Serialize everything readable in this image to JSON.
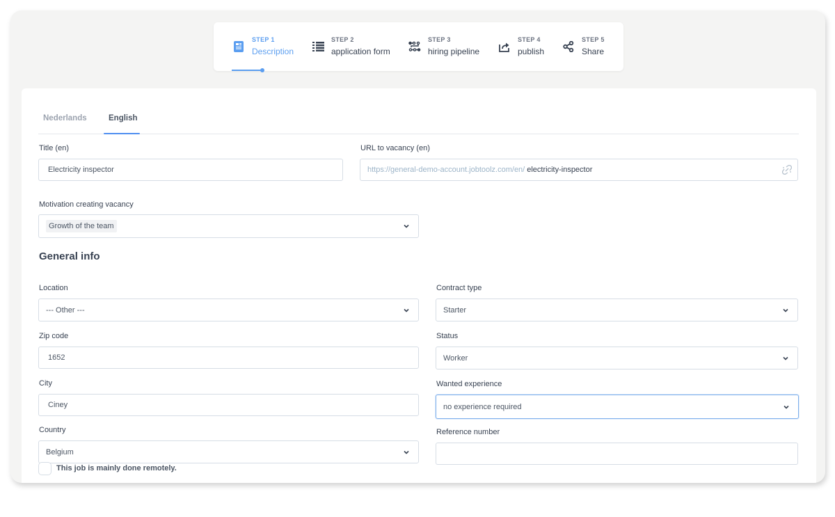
{
  "stepper": {
    "steps": [
      {
        "number": "STEP 1",
        "label": "Description",
        "icon": "document-icon",
        "active": true
      },
      {
        "number": "STEP 2",
        "label": "application form",
        "icon": "list-icon",
        "active": false
      },
      {
        "number": "STEP 3",
        "label": "hiring pipeline",
        "icon": "pipeline-icon",
        "active": false
      },
      {
        "number": "STEP 4",
        "label": "publish",
        "icon": "share-box-icon",
        "active": false
      },
      {
        "number": "STEP 5",
        "label": "Share",
        "icon": "share-icon",
        "active": false
      }
    ]
  },
  "language_tabs": {
    "tabs": [
      {
        "label": "Nederlands",
        "active": false
      },
      {
        "label": "English",
        "active": true
      }
    ]
  },
  "form": {
    "title": {
      "label": "Title (en)",
      "value": "Electricity inspector"
    },
    "url": {
      "label": "URL to vacancy (en)",
      "prefix": "https://general-demo-account.jobtoolz.com/en/",
      "slug": "electricity-inspector"
    },
    "motivation": {
      "label": "Motivation creating vacancy",
      "value": "Growth of the team"
    },
    "general_info_heading": "General info",
    "location": {
      "label": "Location",
      "value": "--- Other ---"
    },
    "zip_code": {
      "label": "Zip code",
      "value": "1652"
    },
    "city": {
      "label": "City",
      "value": "Ciney"
    },
    "country": {
      "label": "Country",
      "value": "Belgium"
    },
    "contract_type": {
      "label": "Contract type",
      "value": "Starter"
    },
    "status": {
      "label": "Status",
      "value": "Worker"
    },
    "wanted_experience": {
      "label": "Wanted experience",
      "value": "no experience required"
    },
    "reference_number": {
      "label": "Reference number",
      "value": ""
    },
    "remote": {
      "label": "This job is mainly done remotely.",
      "checked": false
    }
  },
  "colors": {
    "accent": "#5b9ef0",
    "frame_bg": "#f4f4f3",
    "border": "#d6dde5"
  }
}
